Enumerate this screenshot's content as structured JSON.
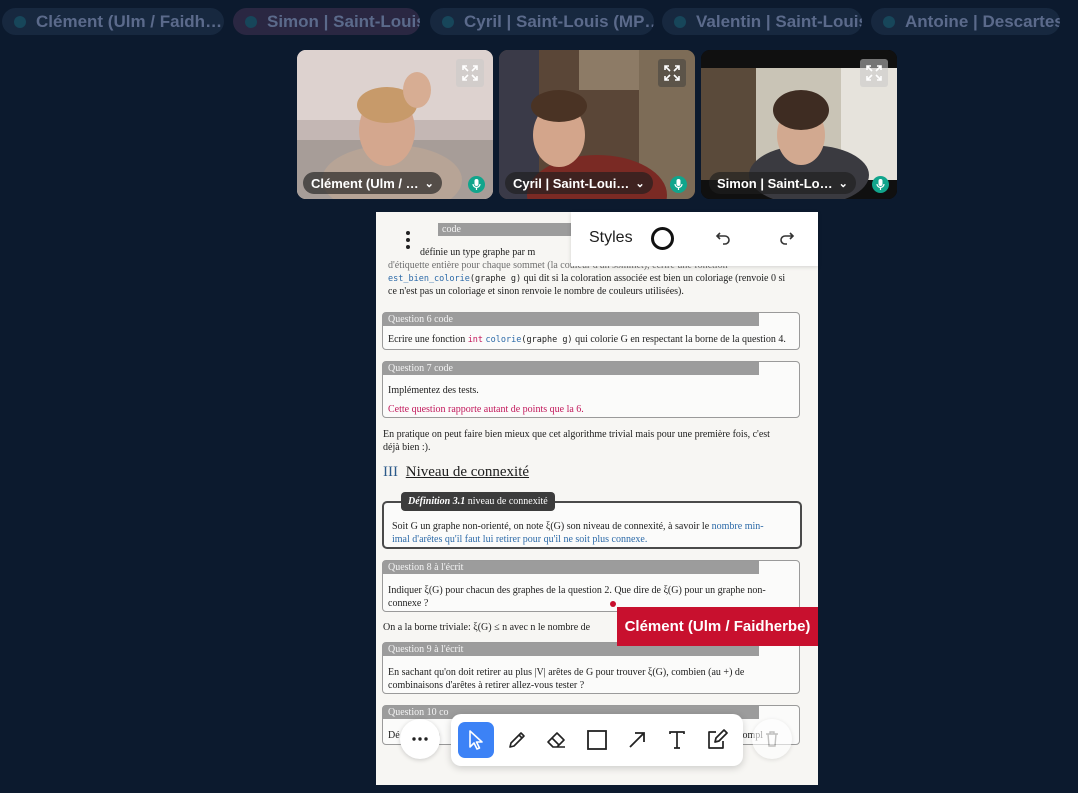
{
  "participants_bar": [
    {
      "name": "Clément (Ulm / Faidh…",
      "bg": "#17283f"
    },
    {
      "name": "Simon | Saint-Louis",
      "bg": "#2a2742"
    },
    {
      "name": "Cyril | Saint-Louis (MP…",
      "bg": "#17283f"
    },
    {
      "name": "Valentin | Saint-Louis",
      "bg": "#17283f"
    },
    {
      "name": "Antoine | Descartes",
      "bg": "#17283f"
    }
  ],
  "videos": [
    {
      "name": "Clément (Ulm / …"
    },
    {
      "name": "Cyril | Saint-Loui…"
    },
    {
      "name": "Simon | Saint-Lo…"
    }
  ],
  "whiteboard_top": {
    "styles_label": "Styles"
  },
  "document": {
    "top_head": "code",
    "q5_lines": [
      "définie un type graphe par m",
      "d'étiquette entière pour chaque sommet (la couleur d'un sommet), écrire une fonction",
      "qui dit si la coloration associée est bien un coloriage (renvoie 0 si",
      "ce n'est pas un coloriage et sinon renvoie le nombre de couleurs utilisées)."
    ],
    "q5_code_fn": "est_bien_colorie",
    "q5_code_arg": "(graphe g)",
    "q6": {
      "head_num": "Question 6",
      "head_tag": "code",
      "text_a": "Ecrire une fonction ",
      "code_int": "int",
      "code_fn": "colorie",
      "code_arg": "(graphe g)",
      "text_b": " qui colorie G en respectant la borne de la question 4."
    },
    "q7": {
      "head_num": "Question 7",
      "head_tag": "code",
      "line1": "Implémentez des tests.",
      "line2": "Cette question rapporte autant de points que la 6."
    },
    "para1": "En pratique on peut faire bien mieux que cet algorithme trivial mais pour une première fois, c'est",
    "para1b": "déjà bien :).",
    "section_num": "III",
    "section_title": "Niveau de connexité",
    "def": {
      "label": "Définition 3.1",
      "name": "niveau de connexité",
      "line1": "Soit G un graphe non-orienté, on note ξ(G) son niveau de connexité, à savoir le",
      "link1": "nombre min-",
      "link2": "imal d'arêtes qu'il faut lui retirer pour qu'il ne soit plus connexe."
    },
    "q8": {
      "head_num": "Question 8",
      "head_tag": "à l'écrit",
      "line1": "Indiquer ξ(G) pour chacun des graphes de la question 2. Que dire de ξ(G) pour un graphe non-",
      "line2": "connexe ?"
    },
    "para2": "On a la borne triviale: ξ(G) ≤ n avec n le nombre de",
    "q9": {
      "head_num": "Question 9",
      "head_tag": "à l'écrit",
      "line1": "En sachant qu'on doit retirer au plus |V| arêtes de G pour trouver ξ(G), combien (au +) de",
      "line2": "combinaisons d'arêtes à retirer allez-vous tester ?"
    },
    "q10": {
      "head_num": "Question 10",
      "head_tag": "co",
      "line_left": "Dé",
      "line_mid": "a b",
      "line_right": "compl"
    }
  },
  "cursor_label": "Clément (Ulm / Faidherbe)",
  "colors": {
    "background": "#0c1a2e",
    "cursor": "#c8102e",
    "active_tool": "#3c82f6",
    "mic": "#11a58c"
  }
}
